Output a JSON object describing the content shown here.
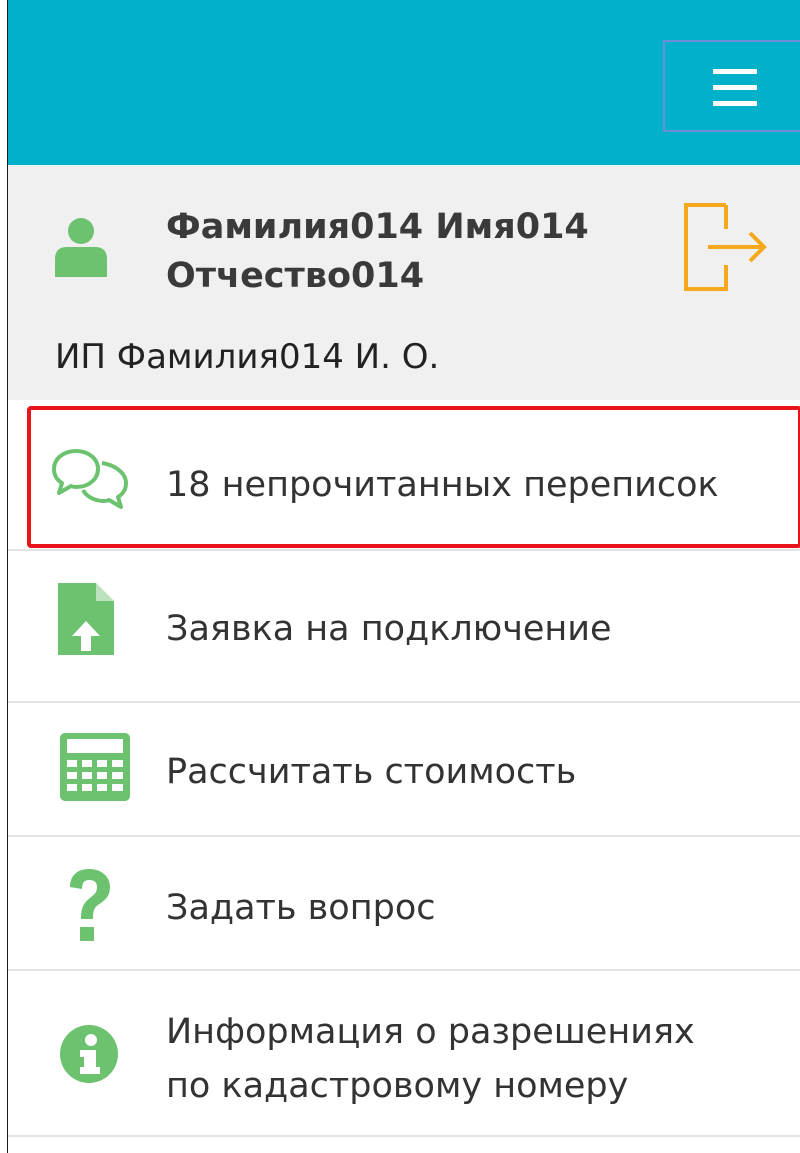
{
  "header": {
    "menu_button": "menu-hamburger-icon",
    "background": "#00b1c9"
  },
  "user": {
    "name_line1": "Фамилия014 Имя014",
    "name_line2": "Отчество014",
    "company": "ИП Фамилия014 И. О.",
    "avatar_icon": "user-icon",
    "logout_icon": "logout-icon"
  },
  "menu": {
    "items": [
      {
        "id": "messages",
        "icon": "chat-icon",
        "label": "18 непрочитанных переписок",
        "highlighted": true
      },
      {
        "id": "connection",
        "icon": "file-upload-icon",
        "label": "Заявка на подключение"
      },
      {
        "id": "calculate",
        "icon": "calculator-icon",
        "label": "Рассчитать стоимость"
      },
      {
        "id": "question",
        "icon": "question-icon",
        "label": "Задать вопрос"
      },
      {
        "id": "permissions",
        "icon": "info-icon",
        "label_line1": "Информация о разрешениях",
        "label_line2": "по кадастровому номеру"
      }
    ]
  },
  "colors": {
    "accent": "#00b1c9",
    "icon_green": "#6cc26f",
    "logout_orange": "#f5a81c",
    "highlight": "#e8131b"
  }
}
